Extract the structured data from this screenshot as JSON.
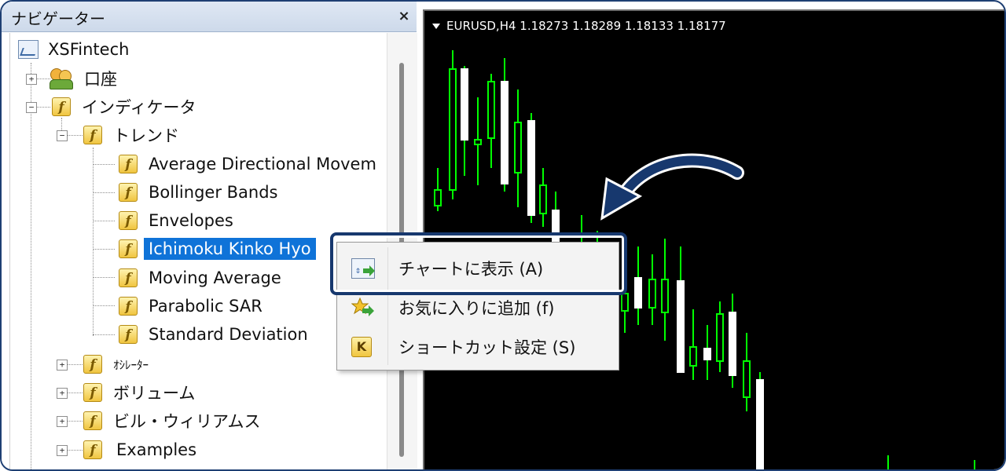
{
  "navigator": {
    "title": "ナビゲーター",
    "close_label": "×",
    "tree": {
      "root": "XSFintech",
      "account": "口座",
      "indicators": "インディケータ",
      "trend": "トレンド",
      "trend_items": [
        "Average Directional Movem",
        "Bollinger Bands",
        "Envelopes",
        "Ichimoku Kinko Hyo",
        "Moving Average",
        "Parabolic SAR",
        "Standard Deviation"
      ],
      "oscillators": "ｵｼﾚｰﾀｰ",
      "volumes": "ボリューム",
      "bill_williams": "ビル・ウィリアムス",
      "examples": "Examples"
    }
  },
  "chart": {
    "title": "EURUSD,H4  1.18273 1.18289 1.18133 1.18177",
    "colors": {
      "background": "#000000",
      "up": "#00ff00",
      "down": "#ffffff"
    }
  },
  "context_menu": {
    "items": [
      {
        "label": "チャートに表示 (A)",
        "icon": "chart-icon"
      },
      {
        "label": "お気に入りに追加 (f)",
        "icon": "star-icon"
      },
      {
        "label": "ショートカット設定 (S)",
        "icon": "k-icon"
      }
    ]
  },
  "accent_color": "#17386e",
  "selection_color": "#0f73d8"
}
